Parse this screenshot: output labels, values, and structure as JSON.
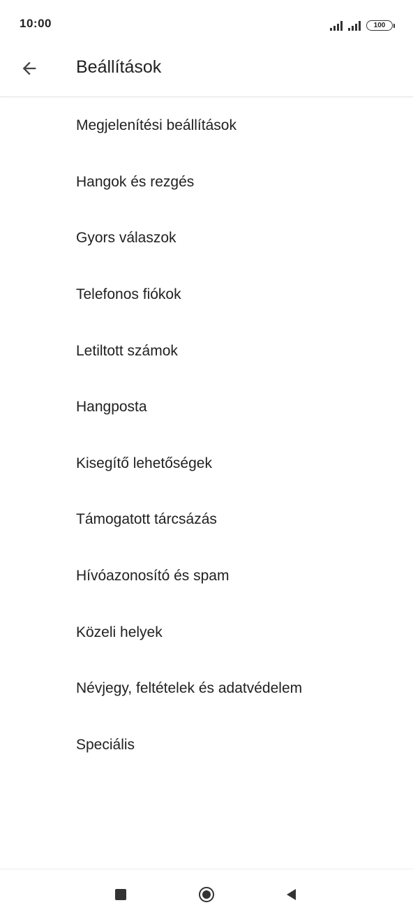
{
  "status_bar": {
    "time": "10:00",
    "battery": "100",
    "icons": [
      "signal-icon",
      "signal-icon",
      "battery-icon"
    ]
  },
  "header": {
    "title": "Beállítások",
    "back_icon": "arrow-back-icon"
  },
  "settings": {
    "items": [
      {
        "label": "Megjelenítési beállítások"
      },
      {
        "label": "Hangok és rezgés"
      },
      {
        "label": "Gyors válaszok"
      },
      {
        "label": "Telefonos fiókok"
      },
      {
        "label": "Letiltott számok"
      },
      {
        "label": "Hangposta"
      },
      {
        "label": "Kisegítő lehetőségek"
      },
      {
        "label": "Támogatott tárcsázás"
      },
      {
        "label": "Hívóazonosító és spam"
      },
      {
        "label": "Közeli helyek"
      },
      {
        "label": "Névjegy, feltételek és adatvédelem"
      },
      {
        "label": "Speciális"
      }
    ]
  },
  "nav_bar": {
    "icons": [
      "recents-square-icon",
      "home-circle-icon",
      "back-triangle-icon"
    ]
  },
  "colors": {
    "text_primary": "#212121",
    "icon": "#333333",
    "background": "#ffffff",
    "divider": "#e6e6e6"
  }
}
